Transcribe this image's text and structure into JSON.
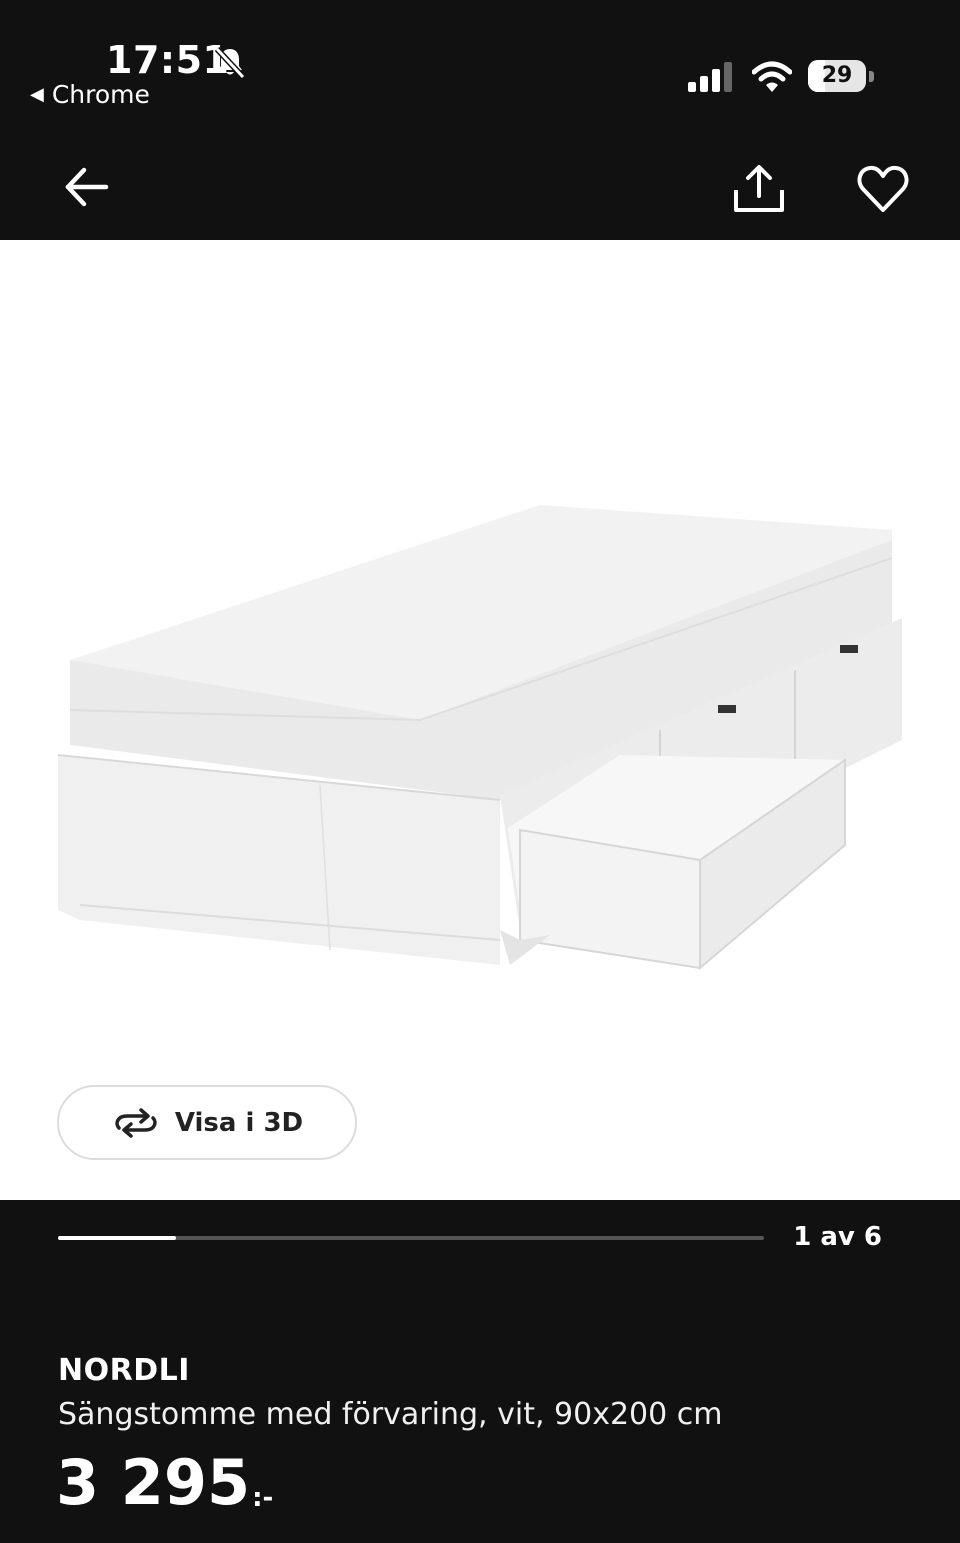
{
  "status_bar": {
    "time": "17:51",
    "back_app": "Chrome",
    "battery": "29",
    "battery_level_percent": 29
  },
  "nav": {
    "back_icon": "arrow-left-icon",
    "share_icon": "share-icon",
    "favorite_icon": "heart-icon"
  },
  "gallery": {
    "view_3d_label": "Visa i 3D",
    "counter": "1 av 6",
    "current_index": 1,
    "total": 6
  },
  "product": {
    "name": "NORDLI",
    "description": "Sängstomme med förvaring, vit, 90x200 cm",
    "price": "3 295",
    "price_suffix": ":-"
  },
  "colors": {
    "background": "#111111",
    "image_background": "#ffffff",
    "text": "#ffffff"
  }
}
